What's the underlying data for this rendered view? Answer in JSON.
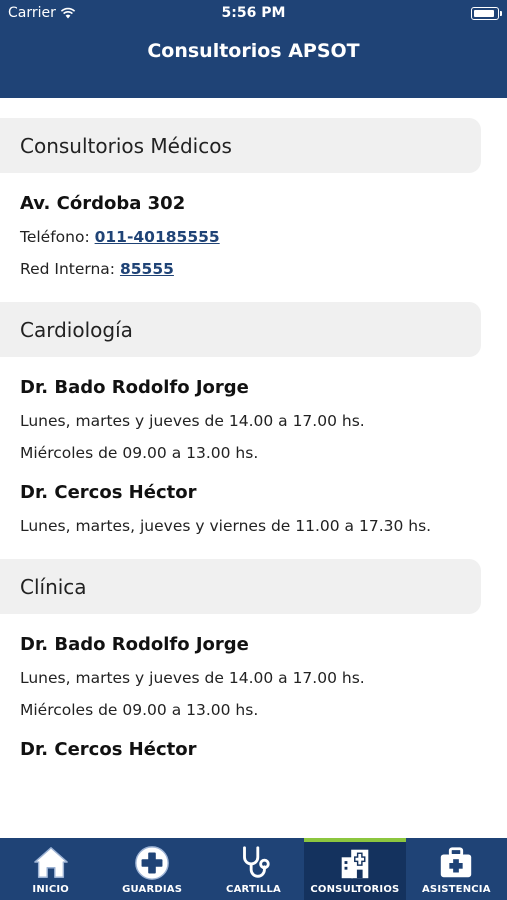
{
  "status_bar": {
    "carrier": "Carrier",
    "time": "5:56 PM",
    "battery_level": 0.95
  },
  "nav": {
    "title": "Consultorios APSOT"
  },
  "sections": [
    {
      "title": "Consultorios Médicos",
      "name": "Av. Córdoba 302",
      "phone_label": "Teléfono: ",
      "phone": "011-40185555",
      "internal_label": "Red Interna: ",
      "internal": "85555"
    },
    {
      "title": "Cardiología",
      "doctors": [
        {
          "name": "Dr. Bado Rodolfo Jorge",
          "lines": [
            "Lunes, martes y jueves de 14.00 a 17.00 hs.",
            "Miércoles de 09.00 a 13.00 hs."
          ]
        },
        {
          "name": "Dr. Cercos Héctor",
          "lines": [
            "Lunes, martes, jueves y viernes de 11.00 a 17.30 hs."
          ]
        }
      ]
    },
    {
      "title": "Clínica",
      "doctors": [
        {
          "name": "Dr. Bado Rodolfo Jorge",
          "lines": [
            "Lunes, martes y jueves de 14.00 a 17.00 hs.",
            "Miércoles de 09.00 a 13.00 hs."
          ]
        },
        {
          "name": "Dr. Cercos Héctor",
          "lines": []
        }
      ]
    }
  ],
  "tabs": [
    {
      "label": "INICIO",
      "icon": "home-icon"
    },
    {
      "label": "GUARDIAS",
      "icon": "plus-icon"
    },
    {
      "label": "CARTILLA",
      "icon": "stethoscope-icon"
    },
    {
      "label": "CONSULTORIOS",
      "icon": "hospital-icon",
      "active": true
    },
    {
      "label": "ASISTENCIA",
      "icon": "first-aid-kit-icon"
    }
  ],
  "colors": {
    "primary": "#1f4376",
    "active_tab": "#14325e",
    "active_indicator": "#8cc63f",
    "section_bg": "#f0f0f0"
  }
}
